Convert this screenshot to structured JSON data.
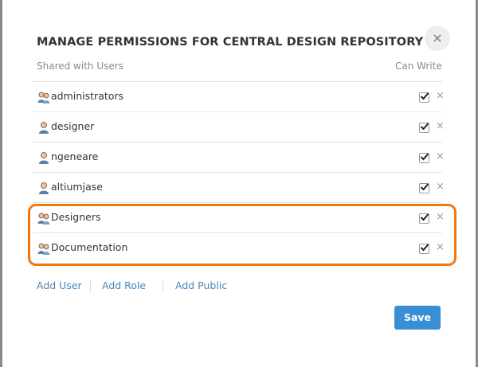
{
  "dialog": {
    "title": "MANAGE PERMISSIONS FOR CENTRAL DESIGN REPOSITORY",
    "close_glyph": "×"
  },
  "table": {
    "col_users": "Shared with Users",
    "col_write": "Can Write",
    "rows": [
      {
        "name": "administrators",
        "icon": "group-icon",
        "can_write": true
      },
      {
        "name": "designer",
        "icon": "user-icon",
        "can_write": true
      },
      {
        "name": "ngeneare",
        "icon": "user-icon",
        "can_write": true
      },
      {
        "name": "altiumjase",
        "icon": "user-icon",
        "can_write": true
      },
      {
        "name": "Designers",
        "icon": "group-icon",
        "can_write": true
      },
      {
        "name": "Documentation",
        "icon": "group-icon",
        "can_write": true
      }
    ],
    "remove_glyph": "×"
  },
  "actions": {
    "add_user": "Add User",
    "add_role": "Add Role",
    "add_public": "Add Public"
  },
  "footer": {
    "save_label": "Save"
  },
  "colors": {
    "accent": "#3a8ed4",
    "highlight": "#f07a10",
    "link": "#4a86b8"
  }
}
